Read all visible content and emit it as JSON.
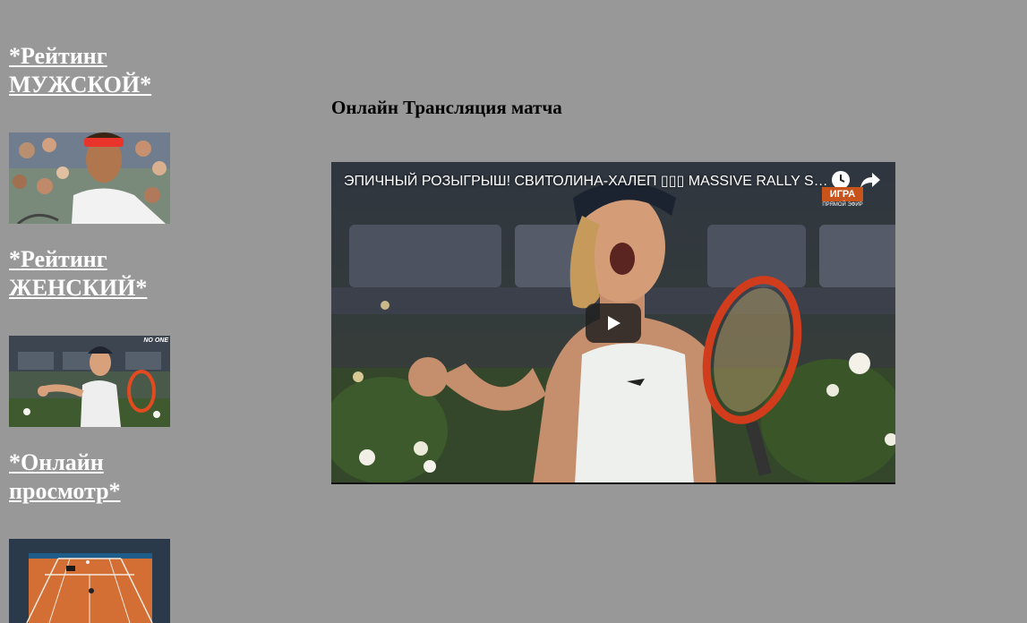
{
  "sidebar": {
    "men_rating_link": "*Рейтинг МУЖСКОЙ*",
    "women_rating_link": "*Рейтинг ЖЕНСКИЙ*",
    "online_view_link": "*Онлайн просмотр*",
    "women_thumb_badge": "NO ONE"
  },
  "main": {
    "heading": "Онлайн Трансляция матча"
  },
  "video": {
    "title": "ЭПИЧНЫЙ РОЗЫГРЫШ! СВИТОЛИНА-ХАЛЕП ▯▯▯ MASSIVE RALLY SVITOLINA HALEP",
    "channel_name": "ИГРА",
    "channel_subtitle": "ПРЯМОЙ ЭФИР",
    "icons": {
      "watch_later": "clock-icon",
      "share": "share-arrow-icon",
      "play": "play-icon"
    }
  },
  "colors": {
    "page_background": "#989898",
    "link_color": "#ffffff",
    "channel_logo": "#c8541c"
  }
}
